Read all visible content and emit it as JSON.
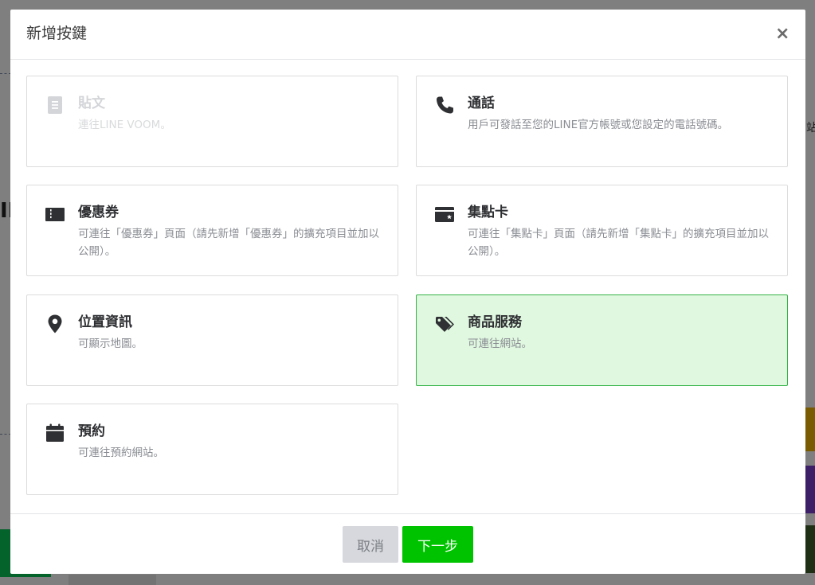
{
  "background": {
    "left_text": "II",
    "right_text": "站"
  },
  "modal": {
    "title": "新增按鍵",
    "close_label": "×",
    "options": [
      {
        "id": "post",
        "icon": "document-icon",
        "title": "貼文",
        "desc": "連往LINE VOOM。",
        "disabled": true,
        "selected": false
      },
      {
        "id": "call",
        "icon": "phone-icon",
        "title": "通話",
        "desc": "用戶可發話至您的LINE官方帳號或您設定的電話號碼。",
        "disabled": false,
        "selected": false
      },
      {
        "id": "coupon",
        "icon": "ticket-icon",
        "title": "優惠券",
        "desc": "可連往「優惠券」頁面（請先新增「優惠券」的擴充項目並加以公開）。",
        "disabled": false,
        "selected": false
      },
      {
        "id": "reward-card",
        "icon": "card-icon",
        "title": "集點卡",
        "desc": "可連往「集點卡」頁面（請先新增「集點卡」的擴充項目並加以公開）。",
        "disabled": false,
        "selected": false
      },
      {
        "id": "location",
        "icon": "map-pin-icon",
        "title": "位置資訊",
        "desc": "可顯示地圖。",
        "disabled": false,
        "selected": false
      },
      {
        "id": "products",
        "icon": "tags-icon",
        "title": "商品服務",
        "desc": "可連往網站。",
        "disabled": false,
        "selected": true
      },
      {
        "id": "booking",
        "icon": "calendar-icon",
        "title": "預約",
        "desc": "可連往預約網站。",
        "disabled": false,
        "selected": false
      }
    ],
    "footer": {
      "cancel_label": "取消",
      "next_label": "下一步"
    }
  },
  "colors": {
    "accent_green": "#00c300",
    "selected_bg": "#e0f8e0",
    "selected_border": "#34b346"
  }
}
